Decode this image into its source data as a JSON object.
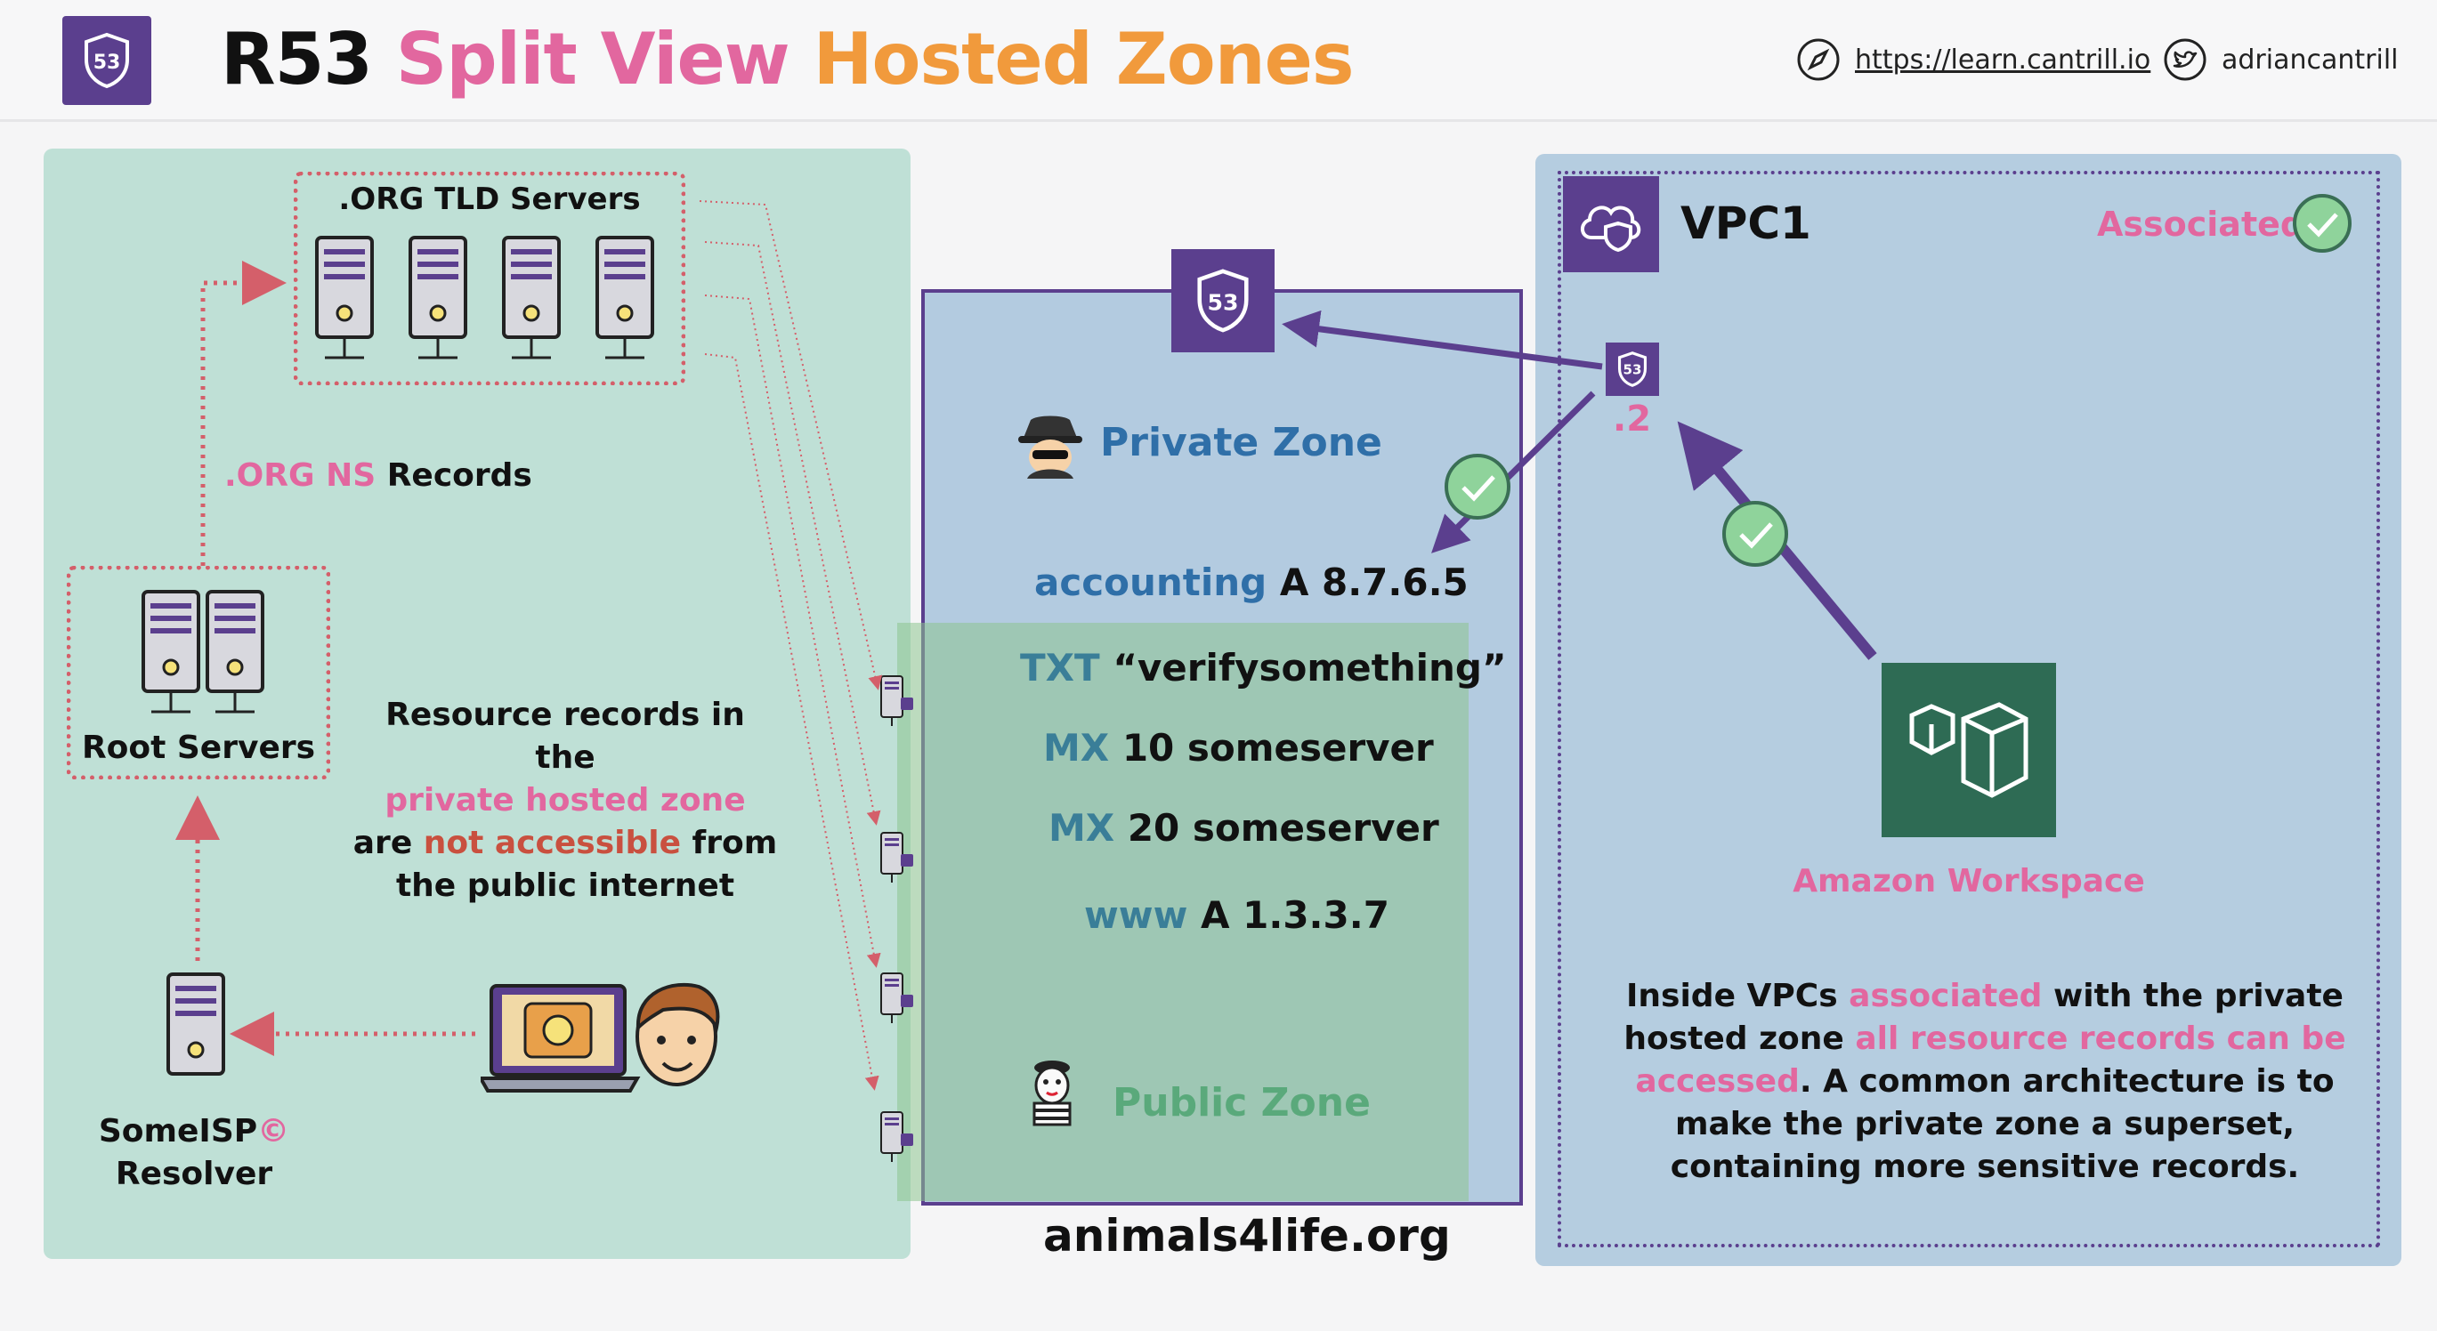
{
  "header": {
    "title_prefix": "R53",
    "title_middle": "Split View",
    "title_suffix": "Hosted Zones",
    "website": "https://learn.cantrill.io",
    "twitter": "adriancantrill",
    "logo_icon": "route53-shield-icon"
  },
  "left": {
    "tld_label": ".ORG TLD Servers",
    "ns_records_pink": ".ORG NS",
    "ns_records_black": "Records",
    "root_label": "Root Servers",
    "resolver_line1": "SomeISP",
    "resolver_mark": "©",
    "resolver_line2": "Resolver",
    "note": {
      "line1": "Resource records in the",
      "line2_pink": "private hosted zone",
      "line3_a": "are",
      "line3_red": "not accessible",
      "line3_b": "from",
      "line4": "the public internet"
    }
  },
  "middle": {
    "private_zone_label": "Private Zone",
    "public_zone_label": "Public Zone",
    "domain": "animals4life.org",
    "records": [
      {
        "type": "accounting",
        "value": "A 8.7.6.5"
      },
      {
        "type": "TXT",
        "value": "“verifysomething”"
      },
      {
        "type": "MX",
        "value": "10 someserver"
      },
      {
        "type": "MX",
        "value": "20 someserver"
      },
      {
        "type": "www",
        "value": "A 1.3.3.7"
      }
    ]
  },
  "right": {
    "vpc_label": "VPC1",
    "associated_label": "Associated",
    "resolver_ip": ".2",
    "workspace_label": "Amazon Workspace",
    "note": {
      "l1_a": "Inside VPCs",
      "l1_pink": "associated",
      "l1_b": "with the private",
      "l2_a": "hosted zone",
      "l2_pink": "all resource records can be",
      "l3_pink": "accessed",
      "l3_b": ". A common architecture is to",
      "l4": "make the private zone a superset,",
      "l5": "containing more sensitive records."
    }
  },
  "colors": {
    "purple": "#5b3f8e",
    "pink": "#e2679f",
    "orange": "#f19a3c",
    "red_dotted": "#d45f6a",
    "left_panel": "#bfe0d6",
    "right_panel": "#b5cde0",
    "workspace": "#2e6b54",
    "check_green": "#8fd39b"
  }
}
